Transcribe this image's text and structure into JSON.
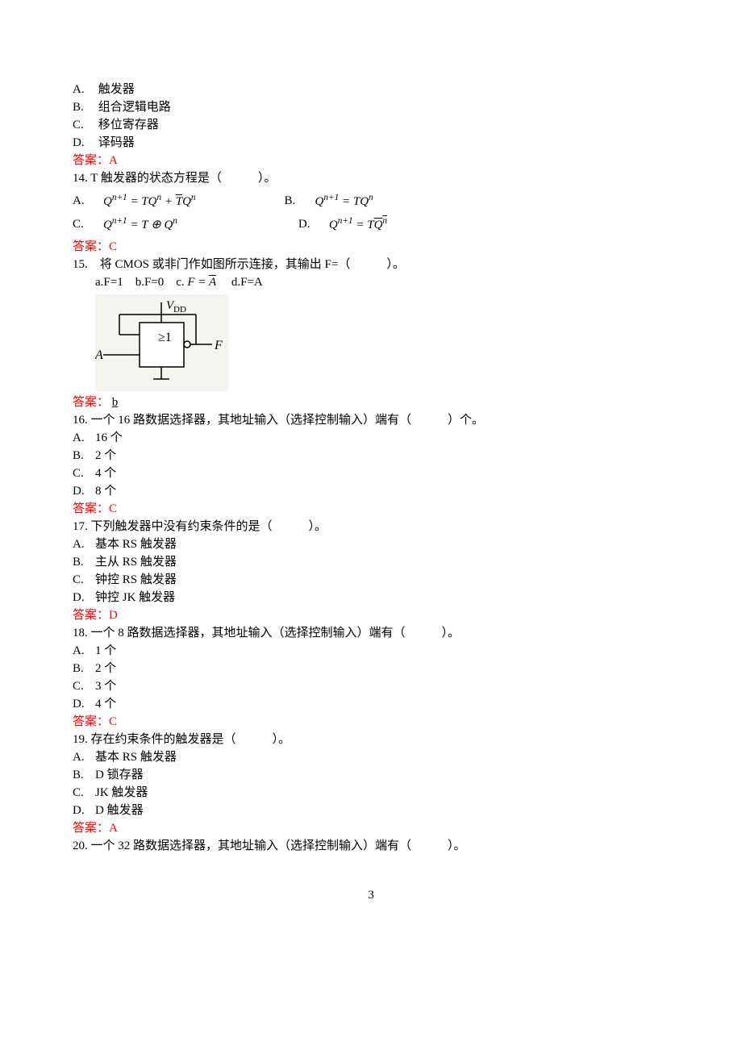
{
  "q13": {
    "optA": "触发器",
    "optB": "组合逻辑电路",
    "optC": "移位寄存器",
    "optD": "译码器",
    "answer": "答案：A"
  },
  "q14": {
    "stem": "14. T 触发器的状态方程是（　　　）。",
    "labelA": "A.",
    "labelB": "B.",
    "labelC": "C.",
    "labelD": "D.",
    "answer": "答案：C"
  },
  "q15": {
    "stem": "15.　将 CMOS 或非门作如图所示连接，其输出 F=（　　　）。",
    "opts_pre": "a.F=1　b.F=0　c. ",
    "opts_post": "　d.F=A",
    "diagram": {
      "vdd": "VDD",
      "a": "A",
      "f": "F",
      "gate": "≥1"
    },
    "answer_prefix": "答案：",
    "answer_val": "b"
  },
  "q16": {
    "stem": "16. 一个 16 路数据选择器，其地址输入（选择控制输入）端有（　　　）个。",
    "optA": "16 个",
    "optB": "2 个",
    "optC": "4 个",
    "optD": "8 个",
    "answer": "答案：C"
  },
  "q17": {
    "stem": "17. 下列触发器中没有约束条件的是（　　　）。",
    "optA": "基本 RS 触发器",
    "optB": "主从 RS 触发器",
    "optC": "钟控 RS 触发器",
    "optD": "钟控 JK 触发器",
    "answer": "答案：D"
  },
  "q18": {
    "stem": "18. 一个 8 路数据选择器，其地址输入（选择控制输入）端有（　　　）。",
    "optA": "1 个",
    "optB": "2 个",
    "optC": "3 个",
    "optD": "4 个",
    "answer": "答案：C"
  },
  "q19": {
    "stem": "19. 存在约束条件的触发器是（　　　）。",
    "optA": "基本 RS 触发器",
    "optB": "D 锁存器",
    "optC": "JK 触发器",
    "optD": "D 触发器",
    "answer": "答案：A"
  },
  "q20": {
    "stem": "20. 一个 32 路数据选择器，其地址输入（选择控制输入）端有（　　　）。"
  },
  "labels": {
    "A": "A.",
    "B": "B.",
    "C": "C.",
    "D": "D."
  },
  "page_number": "3"
}
